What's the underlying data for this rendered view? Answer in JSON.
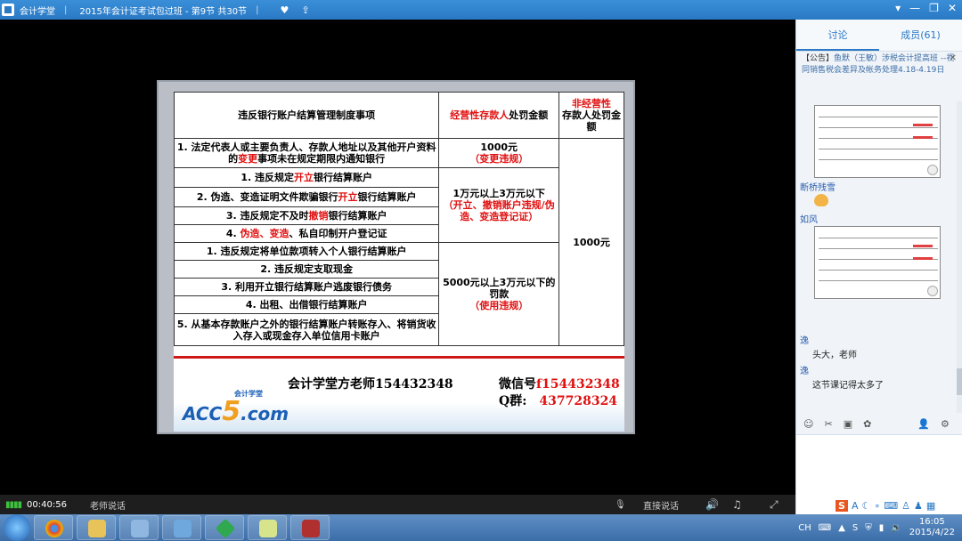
{
  "window": {
    "app_name": "会计学堂",
    "course_title": "2015年会计证考试包过班 - 第9节 共30节"
  },
  "player": {
    "elapsed": "00:40:56",
    "teacher_speaking": "老师说话",
    "direct_speak": "直接说话"
  },
  "slide": {
    "header_item": "违反银行账户结算管理制度事项",
    "header_operating_pre": "经营性存款人",
    "header_operating_post": "处罚金额",
    "header_nonoperating_pre": "非经营性",
    "header_nonoperating_post": "存款人处罚金额",
    "rows": [
      {
        "pre": "1. 法定代表人或主要负责人、存款人地址以及其他开户资料的",
        "hl": "变更",
        "post": "事项未在规定期限内通知银行"
      },
      {
        "pre": "1. 违反规定",
        "hl": "开立",
        "post": "银行结算账户"
      },
      {
        "pre": "2. 伪造、变造证明文件欺骗银行",
        "hl": "开立",
        "post": "银行结算账户"
      },
      {
        "pre": "3. 违反规定不及时",
        "hl": "撤销",
        "post": "银行结算账户"
      },
      {
        "pre": "4. ",
        "hl": "伪造、变造",
        "post": "、私自印制开户登记证"
      },
      {
        "pre": "1. 违反规定将单位款项转入个人银行结算账户",
        "hl": "",
        "post": ""
      },
      {
        "pre": "2. 违反规定支取现金",
        "hl": "",
        "post": ""
      },
      {
        "pre": "3. 利用开立银行结算账户逃废银行债务",
        "hl": "",
        "post": ""
      },
      {
        "pre": "4. 出租、出借银行结算账户",
        "hl": "",
        "post": ""
      },
      {
        "pre": "5. 从基本存款账户之外的银行结算账户转账存入、将销货收入存入或现金存入单位信用卡账户",
        "hl": "",
        "post": ""
      }
    ],
    "fine_group1_amount": "1000元",
    "fine_group1_note": "（变更违规）",
    "fine_group2_amount": "1万元以上3万元以下",
    "fine_group2_note": "（开立、撤销账户违规/伪造、变造登记证）",
    "fine_group3_amount": "5000元以上3万元以下的罚款",
    "fine_group3_note": "（使用违规）",
    "fine_nonoperating": "1000元",
    "footer_teacher": "会计学堂方老师154432348",
    "footer_wechat_label": "微信号",
    "footer_wechat": "f154432348",
    "footer_qq_label": "Q群:",
    "footer_qq": "437728324",
    "logo_main": "ACC",
    "logo_five": "5",
    "logo_dotcom": ".com",
    "logo_small": "会计学堂"
  },
  "sidebar": {
    "tab_discussion": "讨论",
    "tab_members": "成员(61)",
    "notice_prefix": "【公告】",
    "notice_text": "鱼默（王敏）涉税会计提高班 --视同销售税会差异及帐务处理4.18-4.19日",
    "messages": [
      {
        "user": "断桥残雪",
        "text": ""
      },
      {
        "user": "如风",
        "text": ""
      },
      {
        "user": "逸",
        "text": "头大，老师"
      },
      {
        "user": "逸",
        "text": "这节课记得太多了"
      }
    ]
  },
  "ime": {
    "lang": "A"
  },
  "taskbar": {
    "lang": "CH",
    "time": "16:05",
    "date": "2015/4/22"
  }
}
